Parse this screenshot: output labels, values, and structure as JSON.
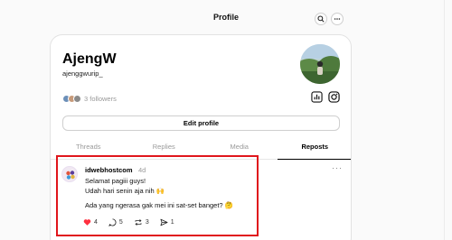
{
  "header": {
    "title": "Profile"
  },
  "profile": {
    "name": "AjengW",
    "handle": "ajenggwurip_",
    "followers_label": "3 followers",
    "edit_label": "Edit profile"
  },
  "tabs": [
    {
      "label": "Threads",
      "active": false
    },
    {
      "label": "Replies",
      "active": false
    },
    {
      "label": "Media",
      "active": false
    },
    {
      "label": "Reposts",
      "active": true
    }
  ],
  "post": {
    "username": "idwebhostcom",
    "time": "4d",
    "more": "···",
    "lines": [
      "Selamat pagiii guys!",
      "Udah hari senin aja nih 🙌",
      "Ada yang ngerasa gak mei ini sat-set banget? 🤔"
    ],
    "counts": {
      "likes": "4",
      "replies": "5",
      "reposts": "3",
      "shares": "1"
    }
  },
  "colors": {
    "like": "#ff3040",
    "highlight": "#e0161c"
  }
}
